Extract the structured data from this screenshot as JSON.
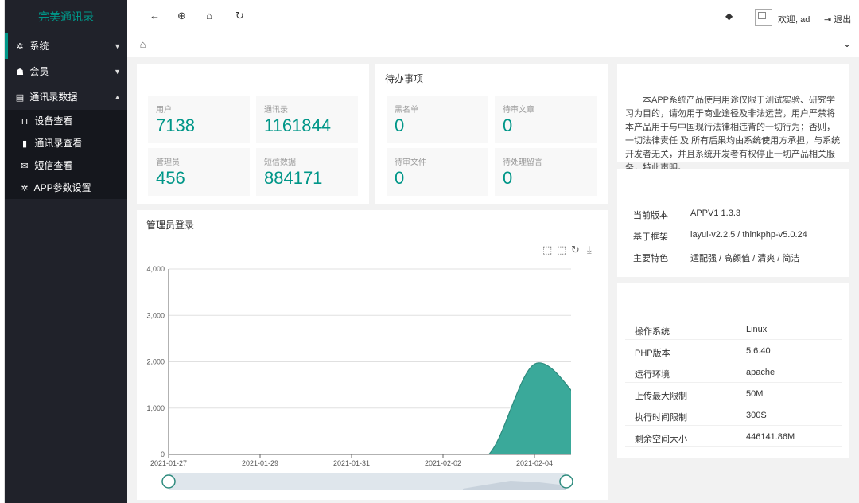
{
  "app": {
    "title": "完美通讯录"
  },
  "sidebar": {
    "items": [
      {
        "label": "系统",
        "icon": "gear-icon"
      },
      {
        "label": "会员",
        "icon": "users-icon"
      },
      {
        "label": "通讯录数据",
        "icon": "table-icon"
      }
    ],
    "sub_items": [
      {
        "label": "设备查看",
        "icon": "lock-icon"
      },
      {
        "label": "通讯录查看",
        "icon": "book-icon"
      },
      {
        "label": "短信查看",
        "icon": "mail-icon"
      },
      {
        "label": "APP参数设置",
        "icon": "gear-icon"
      }
    ]
  },
  "header": {
    "welcome": "欢迎, ad",
    "logout": "退出"
  },
  "stats": {
    "left": [
      {
        "label": "用户",
        "value": "7138"
      },
      {
        "label": "通讯录",
        "value": "1161844"
      },
      {
        "label": "管理员",
        "value": "456"
      },
      {
        "label": "短信数据",
        "value": "884171"
      }
    ],
    "todo_title": "待办事项",
    "todo": [
      {
        "label": "黑名单",
        "value": "0"
      },
      {
        "label": "待审文章",
        "value": "0"
      },
      {
        "label": "待审文件",
        "value": "0"
      },
      {
        "label": "待处理留言",
        "value": "0"
      }
    ]
  },
  "notice": {
    "text": "本APP系统产品使用用途仅限于测试实验、研究学习为目的，请勿用于商业途径及非法运营，用户严禁将本产品用于与中国现行法律相违背的一切行为；否则，一切法律责任 及 所有后果均由系统使用方承担，与系统开发者无关，并且系统开发者有权停止一切产品相关服务，特此声明。"
  },
  "version_info": [
    {
      "key": "当前版本",
      "value": "APPV1 1.3.3"
    },
    {
      "key": "基于框架",
      "value": "layui-v2.2.5 / thinkphp-v5.0.24"
    },
    {
      "key": "主要特色",
      "value": "适配强 / 高颜值 / 清爽 / 简洁"
    }
  ],
  "system_info": [
    {
      "key": "操作系统",
      "value": "Linux"
    },
    {
      "key": "PHP版本",
      "value": "5.6.40"
    },
    {
      "key": "运行环境",
      "value": "apache"
    },
    {
      "key": "上传最大限制",
      "value": "50M"
    },
    {
      "key": "执行时间限制",
      "value": "300S"
    },
    {
      "key": "剩余空间大小",
      "value": "446141.86M"
    }
  ],
  "chart_panel_title": "管理员登录",
  "colors": {
    "accent": "#009688",
    "sidebar": "#20222a"
  },
  "chart_data": {
    "type": "area",
    "x": [
      "2021-01-27",
      "2021-01-28",
      "2021-01-29",
      "2021-01-30",
      "2021-01-31",
      "2021-02-01",
      "2021-02-02",
      "2021-02-03",
      "2021-02-04",
      "2021-02-05"
    ],
    "values": [
      0,
      0,
      0,
      0,
      0,
      0,
      0,
      0,
      1950,
      1150
    ],
    "x_tick_labels": [
      "2021-01-27",
      "2021-01-29",
      "2021-01-31",
      "2021-02-02",
      "2021-02-04"
    ],
    "ylim": [
      0,
      4000
    ],
    "y_ticks": [
      "0",
      "1,000",
      "2,000",
      "3,000",
      "4,000"
    ],
    "grid": true,
    "color": "#3aa99a"
  }
}
